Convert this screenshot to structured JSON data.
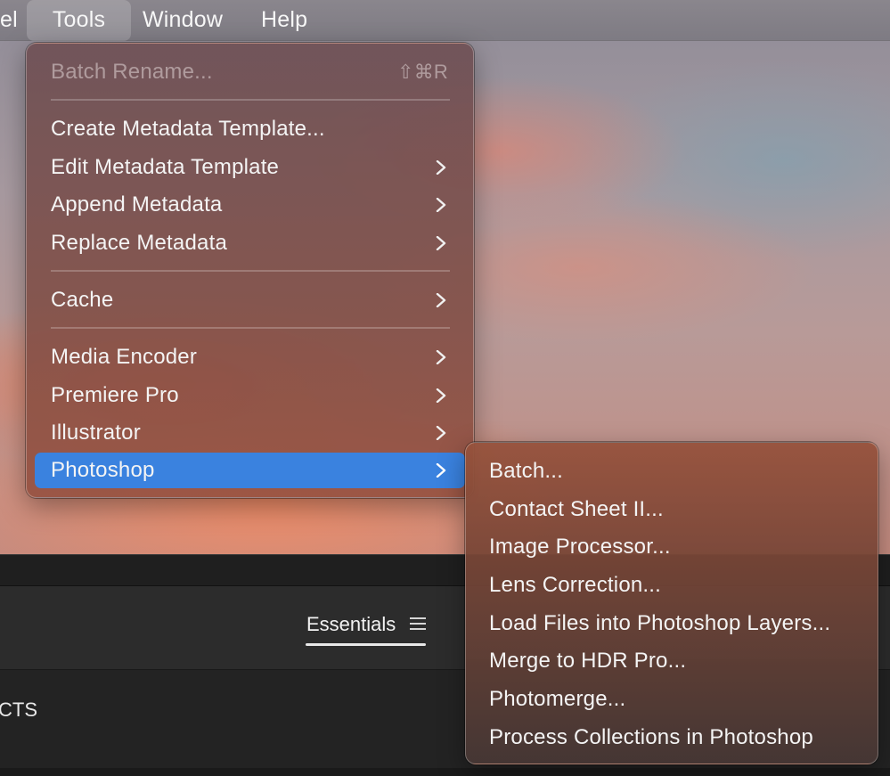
{
  "menubar": {
    "items": [
      {
        "label": "el"
      },
      {
        "label": "Tools"
      },
      {
        "label": "Window"
      },
      {
        "label": "Help"
      }
    ]
  },
  "tools_menu": {
    "batch_rename": {
      "label": "Batch Rename...",
      "shortcut": "⇧⌘R"
    },
    "items": [
      {
        "label": "Create Metadata Template..."
      },
      {
        "label": "Edit Metadata Template"
      },
      {
        "label": "Append Metadata"
      },
      {
        "label": "Replace Metadata"
      },
      {
        "label": "Cache"
      },
      {
        "label": "Media Encoder"
      },
      {
        "label": "Premiere Pro"
      },
      {
        "label": "Illustrator"
      },
      {
        "label": "Photoshop"
      }
    ]
  },
  "photoshop_submenu": {
    "items": [
      {
        "label": "Batch..."
      },
      {
        "label": "Contact Sheet II..."
      },
      {
        "label": "Image Processor..."
      },
      {
        "label": "Lens Correction..."
      },
      {
        "label": "Load Files into Photoshop Layers..."
      },
      {
        "label": "Merge to HDR Pro..."
      },
      {
        "label": "Photomerge..."
      },
      {
        "label": "Process Collections in Photoshop"
      }
    ]
  },
  "workspace": {
    "essentials_label": "Essentials",
    "panel_label": "CTS"
  },
  "colors": {
    "highlight": "#3a82df"
  }
}
